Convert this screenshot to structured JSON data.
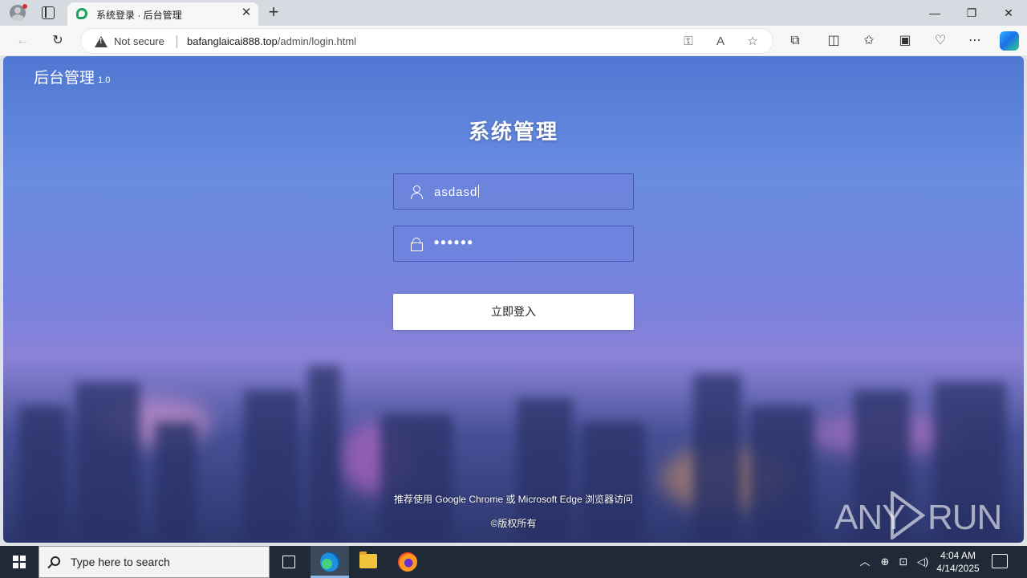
{
  "browser": {
    "tab_title": "系统登录 · 后台管理",
    "tab_close": "✕",
    "new_tab": "+",
    "security_label": "Not secure",
    "url_host": "bafanglaicai888.top",
    "url_path": "/admin/login.html",
    "window_controls": {
      "minimize": "—",
      "restore": "❐",
      "close": "✕"
    }
  },
  "page": {
    "brand": "后台管理",
    "brand_version": "1.0",
    "title": "系统管理",
    "username_value": "asdasd",
    "password_mask": "••••••",
    "login_label": "立即登入",
    "footer_browsers": "推荐使用 Google Chrome 或 Microsoft Edge 浏览器访问",
    "footer_copyright": "©版权所有"
  },
  "watermark": {
    "left": "ANY",
    "right": "RUN"
  },
  "taskbar": {
    "search_placeholder": "Type here to search",
    "time": "4:04 AM",
    "date": "4/14/2025"
  },
  "colors": {
    "page_bg_top": "#5078d2",
    "field_bg": "#6e82dc",
    "button_bg": "#ffffff",
    "taskbar_bg": "#1f2a36"
  }
}
